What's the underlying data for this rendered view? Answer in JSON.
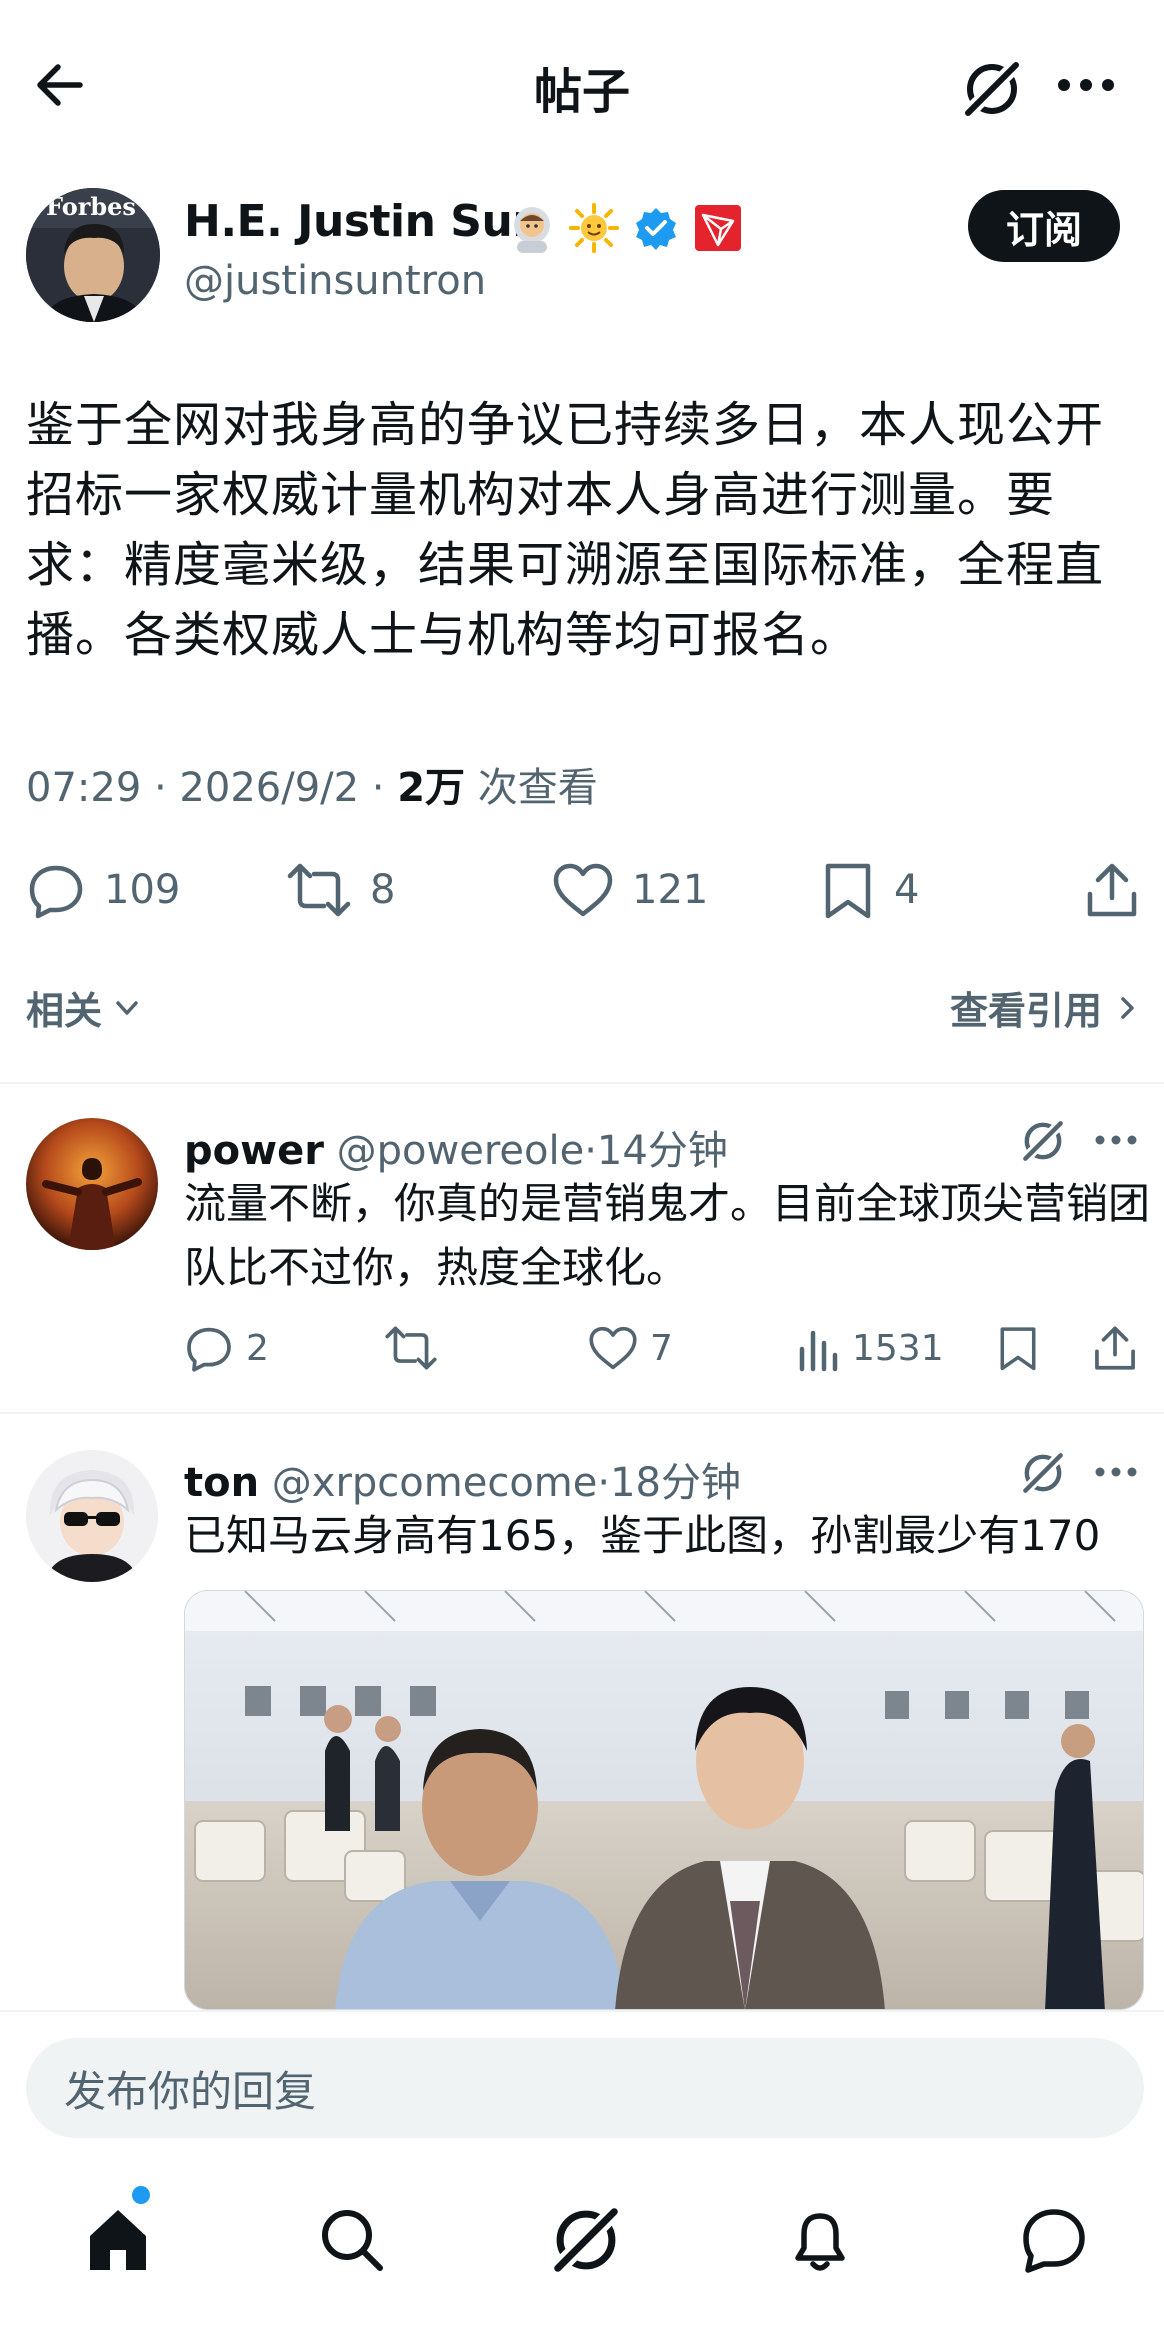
{
  "header": {
    "title": "帖子"
  },
  "post": {
    "author_name": "H.E. Justin Sun",
    "handle": "@justinsuntron",
    "subscribe_label": "订阅",
    "avatar_text": "Forbes",
    "text": "鉴于全网对我身高的争议已持续多日，本人现公开招标一家权威计量机构对本人身高进行测量。要求：精度毫米级，结果可溯源至国际标准，全程直播。各类权威人士与机构等均可报名。",
    "time": "07:29 · 2026/9/2 · ",
    "views": "2万",
    "views_suffix": " 次查看",
    "replies": "109",
    "reposts": "8",
    "likes": "121",
    "bookmarks": "4",
    "related_label": "相关",
    "quotes_label": "查看引用"
  },
  "replies": [
    {
      "name": "power",
      "handle": "@powereole",
      "time": "·14分钟",
      "text": "流量不断，你真的是营销鬼才。目前全球顶尖营销团队比不过你，热度全球化。",
      "replies": "2",
      "reposts": "",
      "likes": "7",
      "views": "1531"
    },
    {
      "name": "ton",
      "handle": "@xrpcomecome",
      "time": "·18分钟",
      "text": "已知马云身高有165，鉴于此图，孙割最少有170"
    }
  ],
  "reply_placeholder": "发布你的回复",
  "colors": {
    "accent": "#1d9bf0",
    "text": "#0f1419",
    "muted": "#536471"
  },
  "icons": [
    "back-arrow-icon",
    "grok-icon",
    "more-icon",
    "verified-icon",
    "tron-icon",
    "reply-icon",
    "repost-icon",
    "like-icon",
    "bookmark-icon",
    "share-icon",
    "views-icon",
    "home-icon",
    "search-icon",
    "bell-icon",
    "messages-icon"
  ]
}
